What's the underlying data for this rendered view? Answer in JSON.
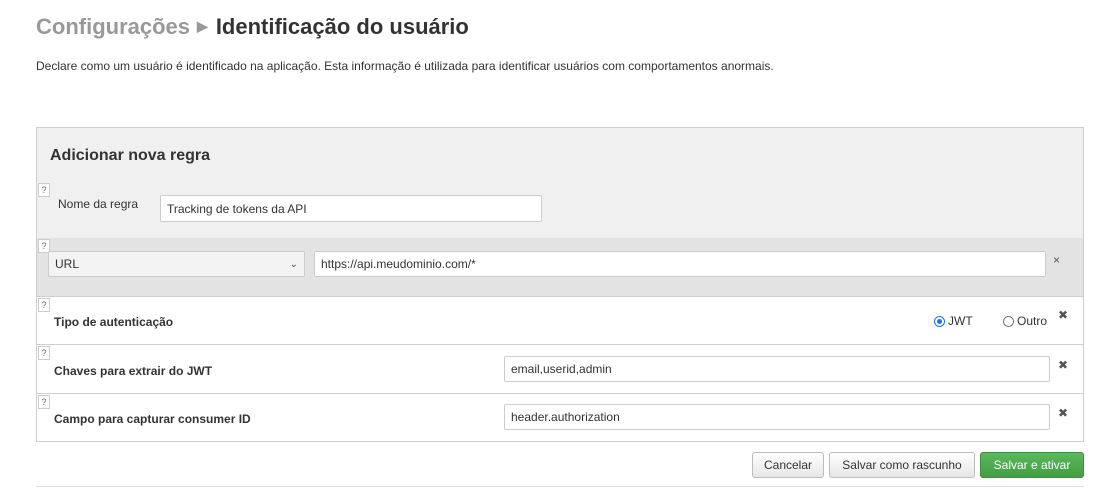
{
  "breadcrumb": {
    "parent": "Configurações",
    "separator_icon": "caret-right-icon",
    "current": "Identificação do usuário"
  },
  "description": "Declare como um usuário é identificado na aplicação. Esta informação é utilizada para identificar usuários com comportamentos anormais.",
  "panel": {
    "title": "Adicionar nova regra",
    "help_glyph": "?",
    "rule_name": {
      "label": "Nome da regra",
      "value": "Tracking de tokens da API"
    },
    "url_row": {
      "select_value": "URL",
      "input_value": "https://api.meudominio.com/*",
      "remove_glyph": "×"
    },
    "auth_row": {
      "label": "Tipo de autenticação",
      "options": [
        {
          "label": "JWT",
          "selected": true
        },
        {
          "label": "Outro",
          "selected": false
        }
      ],
      "remove_glyph": "✖"
    },
    "jwt_keys_row": {
      "label": "Chaves para extrair do JWT",
      "value": "email,userid,admin",
      "remove_glyph": "✖"
    },
    "consumer_row": {
      "label": "Campo para capturar consumer ID",
      "value": "header.authorization",
      "remove_glyph": "✖"
    }
  },
  "actions": {
    "cancel": "Cancelar",
    "save_draft": "Salvar como rascunho",
    "save_activate": "Salvar e ativar"
  },
  "colors": {
    "primary_button": "#5cb85c",
    "radio_selected": "#1a73e8"
  }
}
